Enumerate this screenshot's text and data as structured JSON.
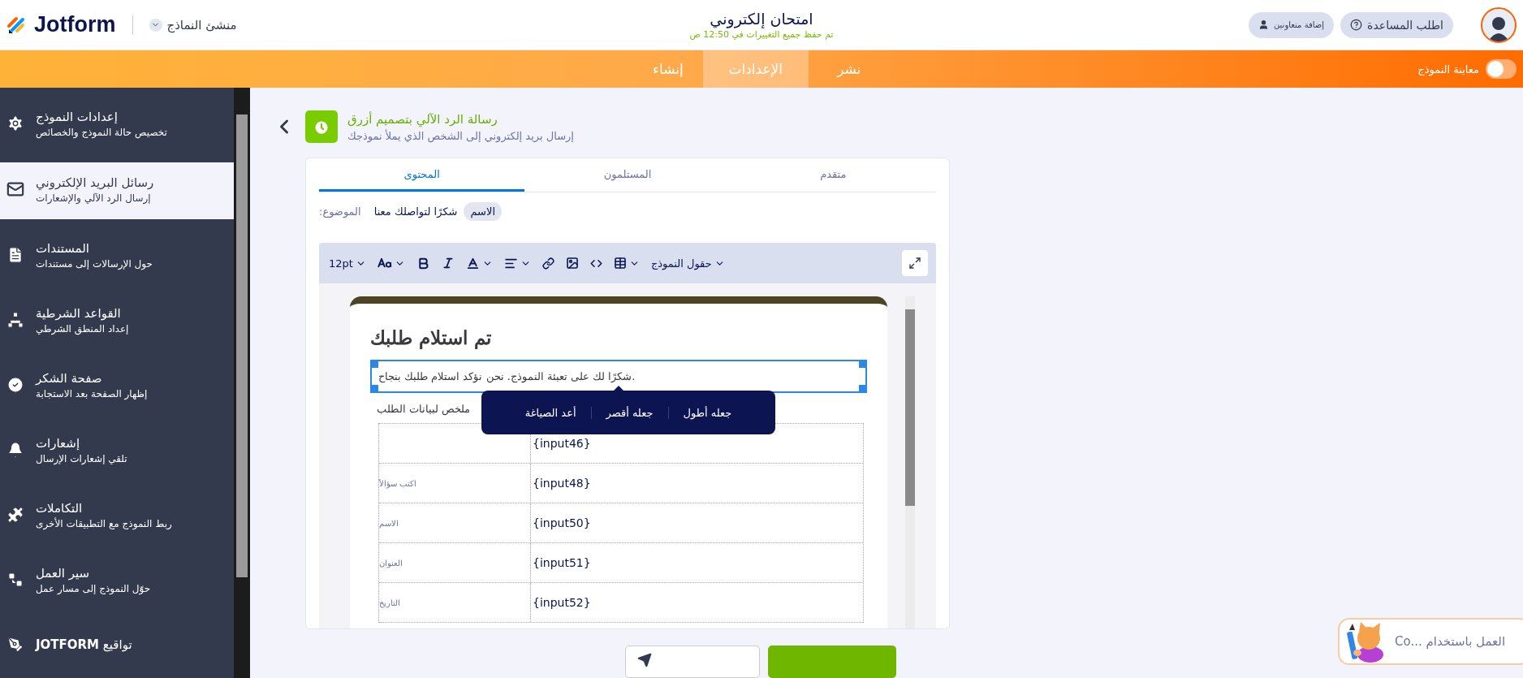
{
  "header": {
    "logo": "Jotform",
    "product": "منشئ النماذج",
    "title": "امتحان إلكتروني",
    "save_status": "تم حفظ جميع التغييرات في 12:50 ص",
    "help_button": "اطلب المساعدة",
    "collaborators_button": "إضافة متعاونين"
  },
  "nav": {
    "tabs": [
      {
        "label": "نشر",
        "selected": false
      },
      {
        "label": "الإعدادات",
        "selected": true
      },
      {
        "label": "إنشاء",
        "selected": false
      }
    ],
    "preview": {
      "label": "معاينة النموذج",
      "on": false
    }
  },
  "sidebar": {
    "items": [
      {
        "title": "إعدادات النموذج",
        "subtitle": "تخصيص حالة النموذج والخصائص",
        "selected": false
      },
      {
        "title": "رسائل البريد الإلكتروني",
        "subtitle": "إرسال الرد الآلي والإشعارات",
        "selected": true
      },
      {
        "title": "المستندات",
        "subtitle": "حول الإرسالات إلى مستندات",
        "selected": false
      },
      {
        "title": "القواعد الشرطية",
        "subtitle": "إعداد المنطق الشرطي",
        "selected": false
      },
      {
        "title": "صفحة الشكر",
        "subtitle": "إظهار الصفحة بعد الاستجابة",
        "selected": false
      },
      {
        "title": "إشعارات",
        "subtitle": "تلقي إشعارات الإرسال",
        "selected": false
      },
      {
        "title": "التكاملات",
        "subtitle": "ربط النموذج مع التطبيقات الأخرى",
        "selected": false
      },
      {
        "title": "سير العمل",
        "subtitle": "حوّل النموذج إلى مسار عمل",
        "selected": false
      },
      {
        "title": "**JOTFORM** تواقيع",
        "selected": false
      }
    ]
  },
  "email": {
    "title": "رسالة الرد الآلي بتصميم أزرق",
    "subtitle": "إرسال بريد إلكتروني إلى الشخص الذي يملأ نموذجك"
  },
  "card": {
    "tabs": [
      {
        "label": "متقدم",
        "selected": false
      },
      {
        "label": "المستلمون",
        "selected": false
      },
      {
        "label": "المحتوى",
        "selected": true
      }
    ],
    "subject": {
      "label": "الموضوع:",
      "text": "شكرًا لتواصلك معنا",
      "chip": "الاسم"
    },
    "toolbar": {
      "font_size": "12pt",
      "fields_menu": "حقول النموذج"
    },
    "preview": {
      "heading": "تم استلام طلبك",
      "paragraph": "شكرًا لك على تعبئة النموذج. نحن نؤكد استلام طلبك بنجاح.",
      "summary": "ملخص لبيانات الطلب",
      "rows": [
        {
          "value": "{input46}"
        },
        {
          "label": "اكتب سؤالاً",
          "value": "{input48}"
        },
        {
          "label": "الاسم",
          "value": "{input50}"
        },
        {
          "label": "العنوان",
          "value": "{input51}"
        },
        {
          "label": "التاريخ",
          "value": "{input52}"
        }
      ]
    },
    "popup": [
      "جعله أطول",
      "جعله أقصر",
      "أعد الصياغة"
    ]
  },
  "assistant": {
    "text": "Co... العمل باستخدام"
  }
}
